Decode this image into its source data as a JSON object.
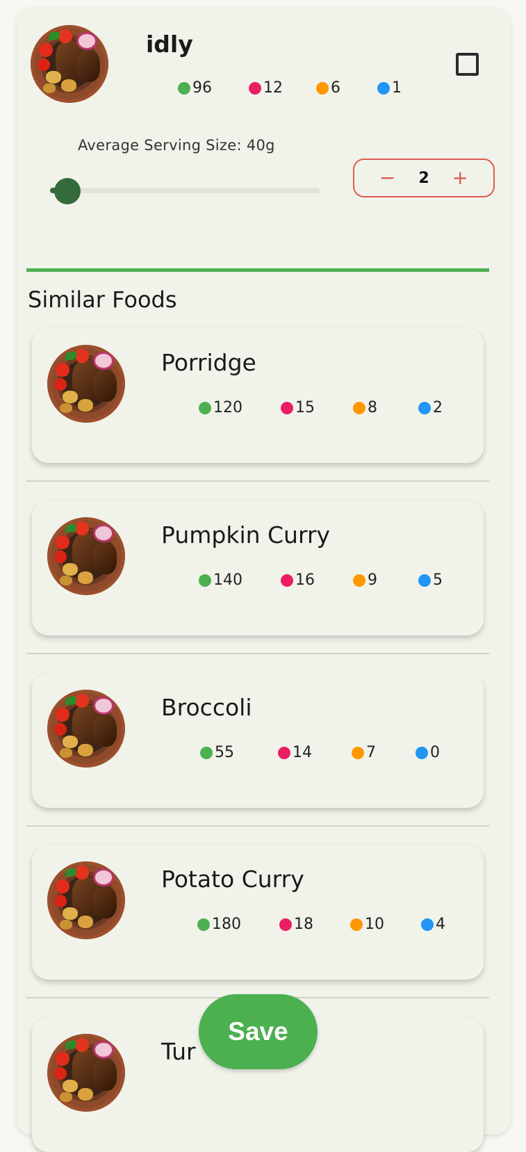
{
  "main_food": {
    "name": "idly",
    "macros": [
      "96",
      "12",
      "6",
      "1"
    ],
    "serving_label": "Average Serving Size: 40g",
    "quantity": "2",
    "minus_symbol": "−",
    "plus_symbol": "+",
    "slider_value": 0.05
  },
  "similar": {
    "title": "Similar Foods",
    "items": [
      {
        "name": "Porridge",
        "macros": [
          "120",
          "15",
          "8",
          "2"
        ]
      },
      {
        "name": "Pumpkin Curry",
        "macros": [
          "140",
          "16",
          "9",
          "5"
        ]
      },
      {
        "name": "Broccoli",
        "macros": [
          "55",
          "14",
          "7",
          "0"
        ]
      },
      {
        "name": "Potato Curry",
        "macros": [
          "180",
          "18",
          "10",
          "4"
        ]
      },
      {
        "name": "Tur",
        "macros": [
          "",
          "",
          "",
          ""
        ]
      }
    ]
  },
  "save_label": "Save",
  "colors": {
    "calories": "#4caf50",
    "protein": "#e91e63",
    "carbs": "#ff9800",
    "fat": "#2196f3",
    "accent": "#4caf50",
    "stepper_border": "#e05a4e"
  }
}
